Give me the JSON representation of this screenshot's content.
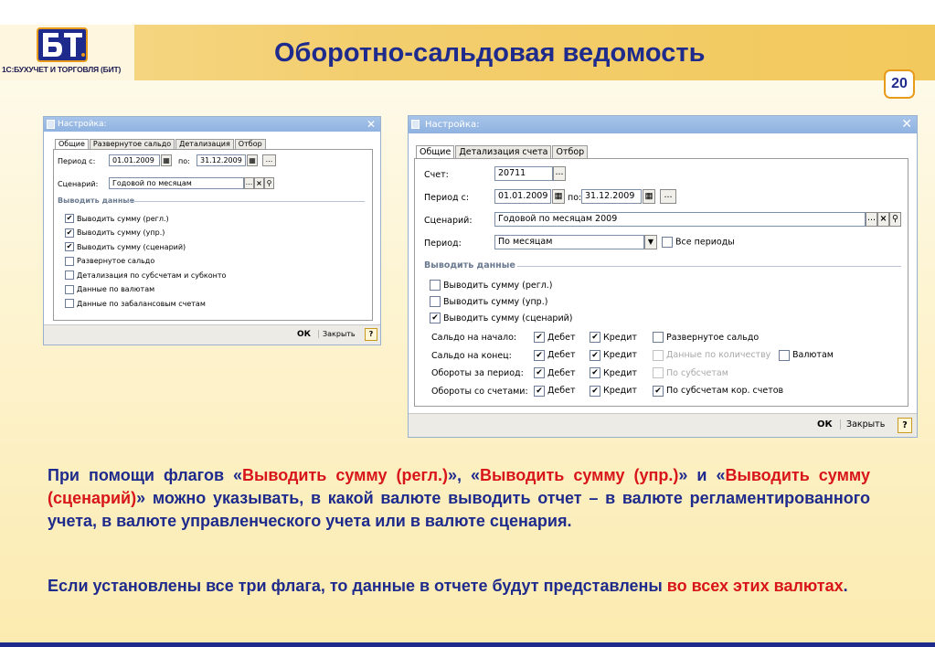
{
  "header": {
    "title": "Оборотно-сальдовая ведомость",
    "page_number": "20",
    "logo_caption": "1С:БУХУЧЕТ И ТОРГОВЛЯ (БИТ)",
    "logo_text": "БТ"
  },
  "dialog1": {
    "title": "Настройка:",
    "tabs": [
      "Общие",
      "Развернутое сальдо",
      "Детализация",
      "Отбор"
    ],
    "period_from_label": "Период с:",
    "period_from": "01.01.2009",
    "period_to_label": "по:",
    "period_to": "31.12.2009",
    "scenario_label": "Сценарий:",
    "scenario": "Годовой по месяцам",
    "section": "Выводить данные",
    "checks": [
      {
        "label": "Выводить сумму (регл.)",
        "checked": true
      },
      {
        "label": "Выводить сумму (упр.)",
        "checked": true
      },
      {
        "label": "Выводить сумму (сценарий)",
        "checked": true
      },
      {
        "label": "Развернутое сальдо",
        "checked": false
      },
      {
        "label": "Детализация по субсчетам и субконто",
        "checked": false
      },
      {
        "label": "Данные по валютам",
        "checked": false
      },
      {
        "label": "Данные по забалансовым счетам",
        "checked": false
      }
    ],
    "ok": "ОК",
    "close": "Закрыть",
    "help": "?"
  },
  "dialog2": {
    "title": "Настройка:",
    "tabs": [
      "Общие",
      "Детализация счета",
      "Отбор"
    ],
    "account_label": "Счет:",
    "account": "20711",
    "period_from_label": "Период с:",
    "period_from": "01.01.2009",
    "period_to_label": "по:",
    "period_to": "31.12.2009",
    "scenario_label": "Сценарий:",
    "scenario": "Годовой по месяцам 2009",
    "period_label": "Период:",
    "period": "По месяцам",
    "all_periods": "Все периоды",
    "section": "Выводить данные",
    "checks": [
      {
        "label": "Выводить сумму (регл.)",
        "checked": false
      },
      {
        "label": "Выводить сумму (упр.)",
        "checked": false
      },
      {
        "label": "Выводить сумму (сценарий)",
        "checked": true
      }
    ],
    "grid": [
      {
        "label": "Сальдо на начало:",
        "debit": "Дебет",
        "credit": "Кредит",
        "extra": "Развернутое сальдо",
        "extra_checked": false,
        "extra_disabled": false,
        "extra2": ""
      },
      {
        "label": "Сальдо на конец:",
        "debit": "Дебет",
        "credit": "Кредит",
        "extra": "Данные по количеству",
        "extra_checked": false,
        "extra_disabled": true,
        "extra2": "Валютам"
      },
      {
        "label": "Обороты за период:",
        "debit": "Дебет",
        "credit": "Кредит",
        "extra": "По субсчетам",
        "extra_checked": false,
        "extra_disabled": true,
        "extra2": ""
      },
      {
        "label": "Обороты со счетами:",
        "debit": "Дебет",
        "credit": "Кредит",
        "extra": "По субсчетам кор. счетов",
        "extra_checked": true,
        "extra_disabled": false,
        "extra2": ""
      }
    ],
    "ok": "ОК",
    "close": "Закрыть",
    "help": "?"
  },
  "body_text": {
    "p1_a": "При помощи флагов «",
    "p1_b": "Выводить сумму (регл.)",
    "p1_c": "», «",
    "p1_d": "Выводить сумму (упр.)",
    "p1_e": "» и «",
    "p1_f": "Выводить сумму (сценарий)",
    "p1_g": "» можно указывать, в какой валюте выводить отчет – в валюте регламентированного учета, в валюте управленческого учета или в валюте сценария.",
    "p2_a": "Если установлены все три флага, то данные в отчете будут представлены ",
    "p2_b": "во всех этих валютах",
    "p2_c": "."
  },
  "colors": {
    "title": "#1f2b8c",
    "accent": "#d8161a",
    "band": "#f3ce6e"
  }
}
